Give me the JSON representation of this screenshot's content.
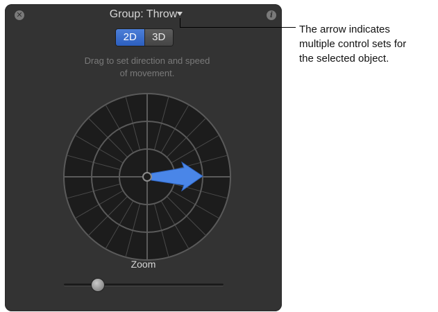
{
  "hud": {
    "title": "Group: Throw",
    "close_icon_glyph": "✕",
    "info_icon_glyph": "i",
    "mode_2d": "2D",
    "mode_3d": "3D",
    "selected_mode": "2D",
    "hint_line1": "Drag to set direction and speed",
    "hint_line2": "of movement.",
    "zoom_label": "Zoom",
    "zoom_value": 0.21
  },
  "callout": {
    "line1": "The arrow indicates",
    "line2": "multiple control sets for",
    "line3": "the selected object."
  },
  "colors": {
    "hud_background": "#333333",
    "accent_blue": "#4a86e8",
    "dial_background": "#1c1c1c",
    "dial_lines": "#5a5a5a"
  },
  "icons": {
    "close": "close-icon",
    "info": "info-icon",
    "title_arrow": "disclosure-triangle-icon",
    "direction": "direction-arrow-icon"
  }
}
